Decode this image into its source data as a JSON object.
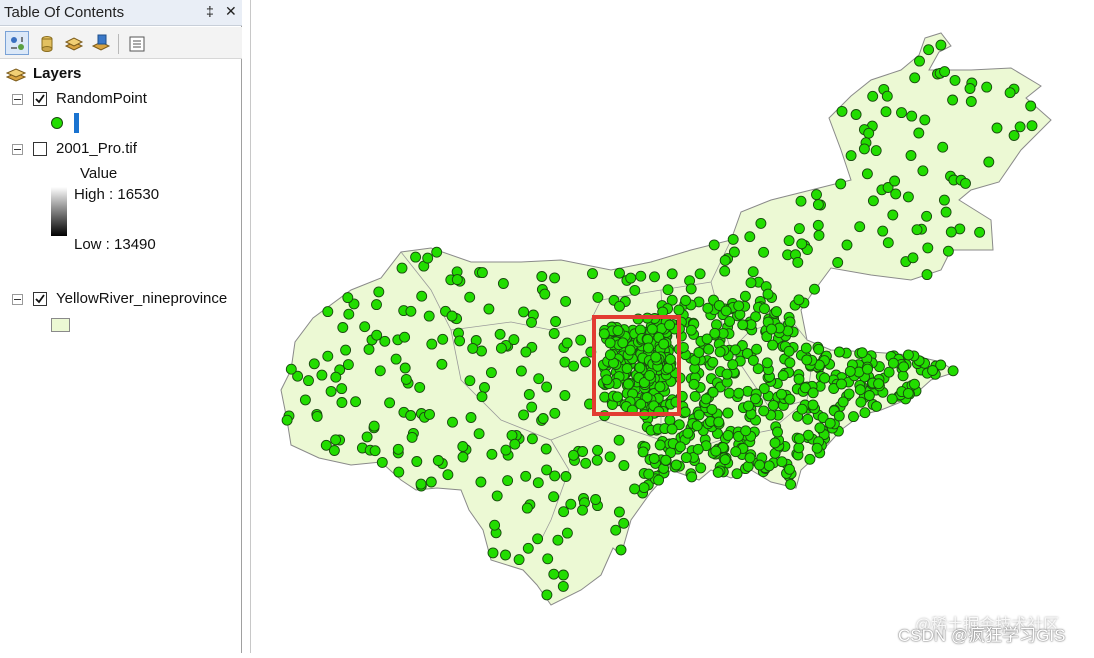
{
  "toc": {
    "title": "Table Of Contents",
    "pin_glyph": "‡",
    "close_glyph": "✕",
    "toolbar": [
      {
        "name": "list-by-drawing-order-icon",
        "active": true
      },
      {
        "name": "list-by-source-icon"
      },
      {
        "name": "list-by-visibility-icon"
      },
      {
        "name": "list-by-selection-icon"
      },
      {
        "name": "options-icon"
      }
    ],
    "root_label": "Layers",
    "layers": [
      {
        "name": "RandomPoint",
        "checked": true,
        "symbol": "green-point"
      },
      {
        "name": "2001_Pro.tif",
        "checked": false,
        "legend_title": "Value",
        "high_label": "High : 16530",
        "low_label": "Low : 13490"
      },
      {
        "name": "YellowRiver_nineprovince",
        "checked": true,
        "symbol": "polygon-fill"
      }
    ]
  },
  "colors": {
    "polygon_fill": "#ecf9d4",
    "polygon_stroke": "#8a8a8a",
    "point_fill": "#22dd00",
    "point_stroke": "#1a4a10",
    "highlight": "#e23c32",
    "selection_bar": "#1a73d0"
  },
  "map": {
    "random_seed": 20011,
    "point_count_approx": 1000
  },
  "watermark": {
    "line1": "@稀土掘金技术社区",
    "line2": "CSDN @疯狂学习GIS"
  }
}
